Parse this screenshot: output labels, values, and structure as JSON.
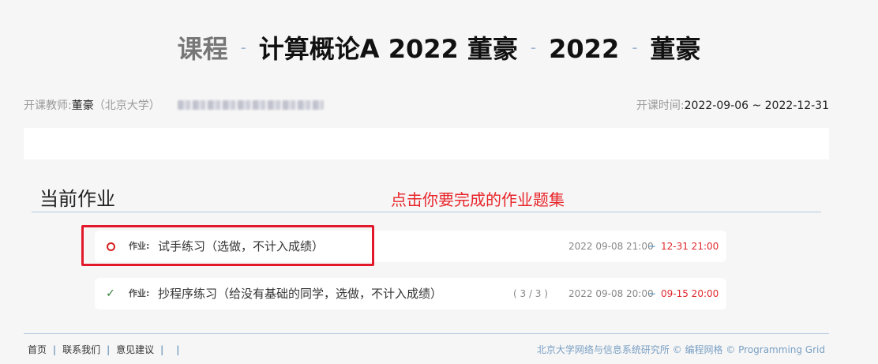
{
  "header": {
    "crumb_course": "课程",
    "course_name": "计算概论A 2022 董豪",
    "year": "2022",
    "teacher_short": "董豪",
    "separator": "-"
  },
  "info": {
    "teacher_label": "开课教师:",
    "teacher_name": "董豪",
    "teacher_affiliation": "（北京大学）",
    "period_label": "开课时间:",
    "period_value": "2022-09-06 ~ 2022-12-31"
  },
  "section": {
    "title": "当前作业",
    "annotation": "点击你要完成的作业题集"
  },
  "homeworks": [
    {
      "status": "not-started",
      "kind": "作业:",
      "name": "试手练习（选做，不计入成绩）",
      "progress": "",
      "start": "2022 09-08 21:00",
      "dash": "~",
      "end": "12-31 21:00"
    },
    {
      "status": "completed",
      "kind": "作业:",
      "name": "抄程序练习（给没有基础的同学，选做，不计入成绩）",
      "progress": "( 3 / 3 )",
      "start": "2022 09-08 20:00",
      "dash": "~",
      "end": "09-15 20:00"
    }
  ],
  "footer": {
    "links": [
      "首页",
      "联系我们",
      "意见建议"
    ],
    "copyright": "北京大学网络与信息系统研究所 © 编程网格 © Programming Grid"
  },
  "colors": {
    "accent_red": "#e8252a",
    "link_blue": "#4a7fb0",
    "done_green": "#2e7d32"
  },
  "icons": {
    "not_started": "red-circle-icon",
    "completed": "checkmark-icon"
  }
}
